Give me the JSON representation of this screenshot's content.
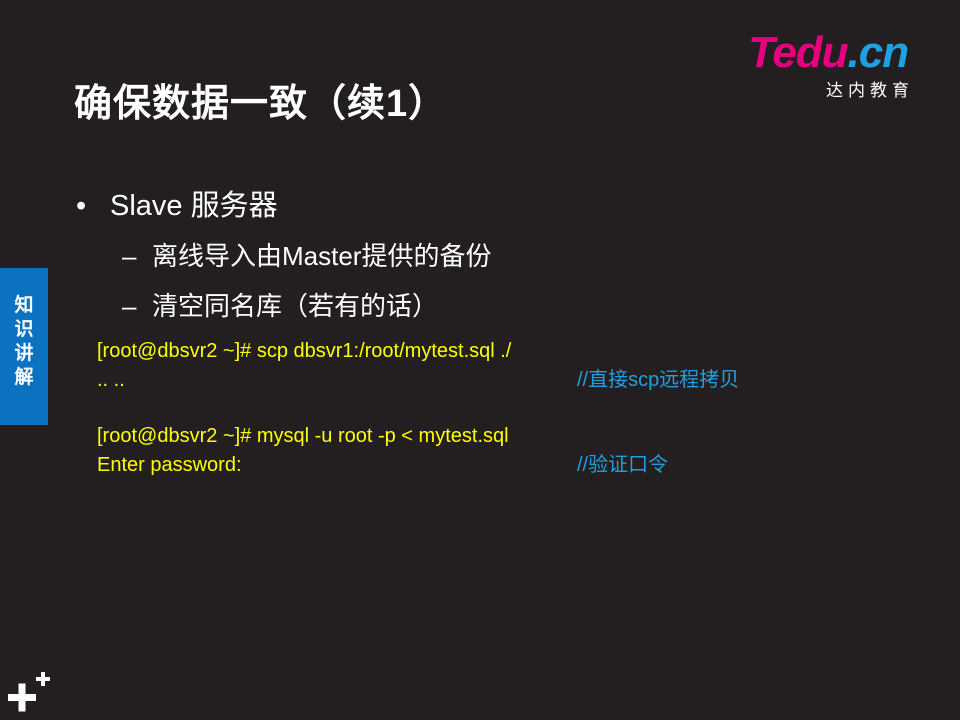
{
  "slide": {
    "title": "确保数据一致（续1）",
    "logo": {
      "brand_t": "T",
      "brand_edu": "edu",
      "brand_dot": ".",
      "brand_cn": "cn",
      "subtitle": "达内教育"
    },
    "side_tab": {
      "label_line1": "知",
      "label_line2": "识",
      "label_line3": "讲",
      "label_line4": "解"
    },
    "bullets": {
      "level1": {
        "marker": "•",
        "text": "Slave 服务器"
      },
      "level2": [
        {
          "marker": "–",
          "text": "离线导入由Master提供的备份"
        },
        {
          "marker": "–",
          "text": "清空同名库（若有的话）"
        }
      ]
    },
    "code": {
      "lines": [
        "[root@dbsvr2 ~]# scp dbsvr1:/root/mytest.sql ./",
        ".. ..",
        "[root@dbsvr2 ~]# mysql -u root -p < mytest.sql",
        "Enter password:"
      ],
      "comments": [
        "//直接scp远程拷贝",
        "//验证口令"
      ]
    },
    "colors": {
      "background": "#231f20",
      "code_text": "#ffff00",
      "comment_text": "#1fa0e0",
      "side_tab": "#0a72c0",
      "logo_magenta": "#e5007f",
      "logo_blue": "#1fa0e0"
    },
    "icons": {
      "corner_icon": "plus-plus-icon"
    }
  }
}
